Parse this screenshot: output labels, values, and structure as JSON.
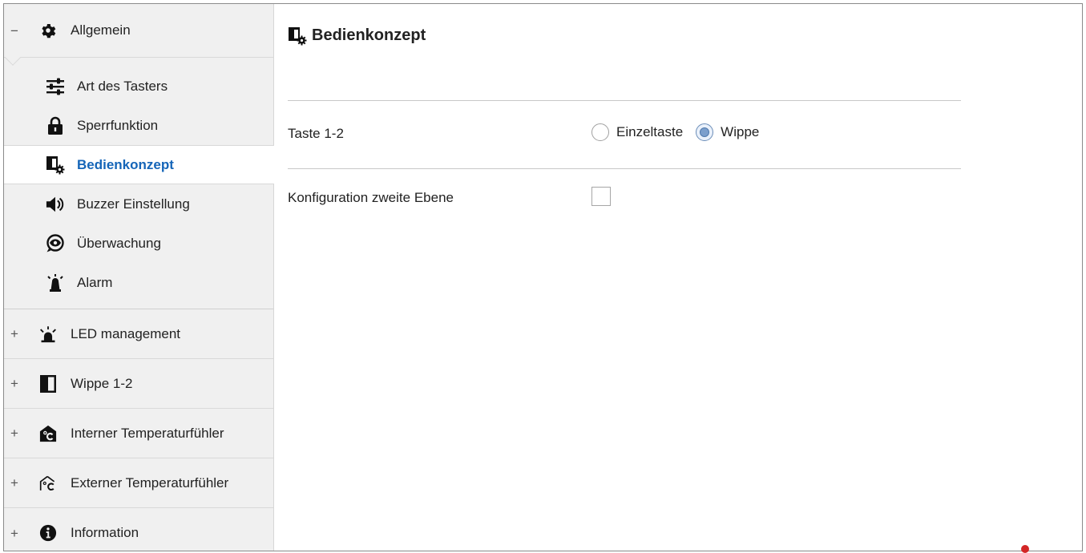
{
  "sidebar": {
    "groups": [
      {
        "toggle": "−",
        "icon": "gear-icon",
        "label": "Allgemein",
        "expanded": true,
        "items": [
          {
            "icon": "sliders-icon",
            "label": "Art des Tasters"
          },
          {
            "icon": "lock-icon",
            "label": "Sperrfunktion"
          },
          {
            "icon": "rocker-config-icon",
            "label": "Bedienkonzept",
            "active": true
          },
          {
            "icon": "speaker-icon",
            "label": "Buzzer Einstellung"
          },
          {
            "icon": "eye-icon",
            "label": "Überwachung"
          },
          {
            "icon": "alarm-bell-icon",
            "label": "Alarm"
          }
        ]
      },
      {
        "toggle": "+",
        "icon": "led-icon",
        "label": "LED management"
      },
      {
        "toggle": "+",
        "icon": "rocker-icon",
        "label": "Wippe 1-2"
      },
      {
        "toggle": "+",
        "icon": "house-temperature-filled-icon",
        "label": "Interner Temperaturfühler"
      },
      {
        "toggle": "+",
        "icon": "house-temperature-outline-icon",
        "label": "Externer Temperaturfühler"
      },
      {
        "toggle": "+",
        "icon": "info-icon",
        "label": "Information"
      }
    ]
  },
  "main": {
    "title_icon": "rocker-config-icon",
    "title": "Bedienkonzept",
    "params": [
      {
        "label": "Taste 1-2",
        "type": "radio",
        "options": [
          "Einzeltaste",
          "Wippe"
        ],
        "selected": "Wippe"
      },
      {
        "label": "Konfiguration zweite Ebene",
        "type": "checkbox",
        "checked": false
      }
    ]
  },
  "colors": {
    "sidebar_bg": "#f0f0f0",
    "active_text": "#1565b8",
    "radio_selected": "#7c9fcc",
    "indicator_red": "#d32626"
  }
}
